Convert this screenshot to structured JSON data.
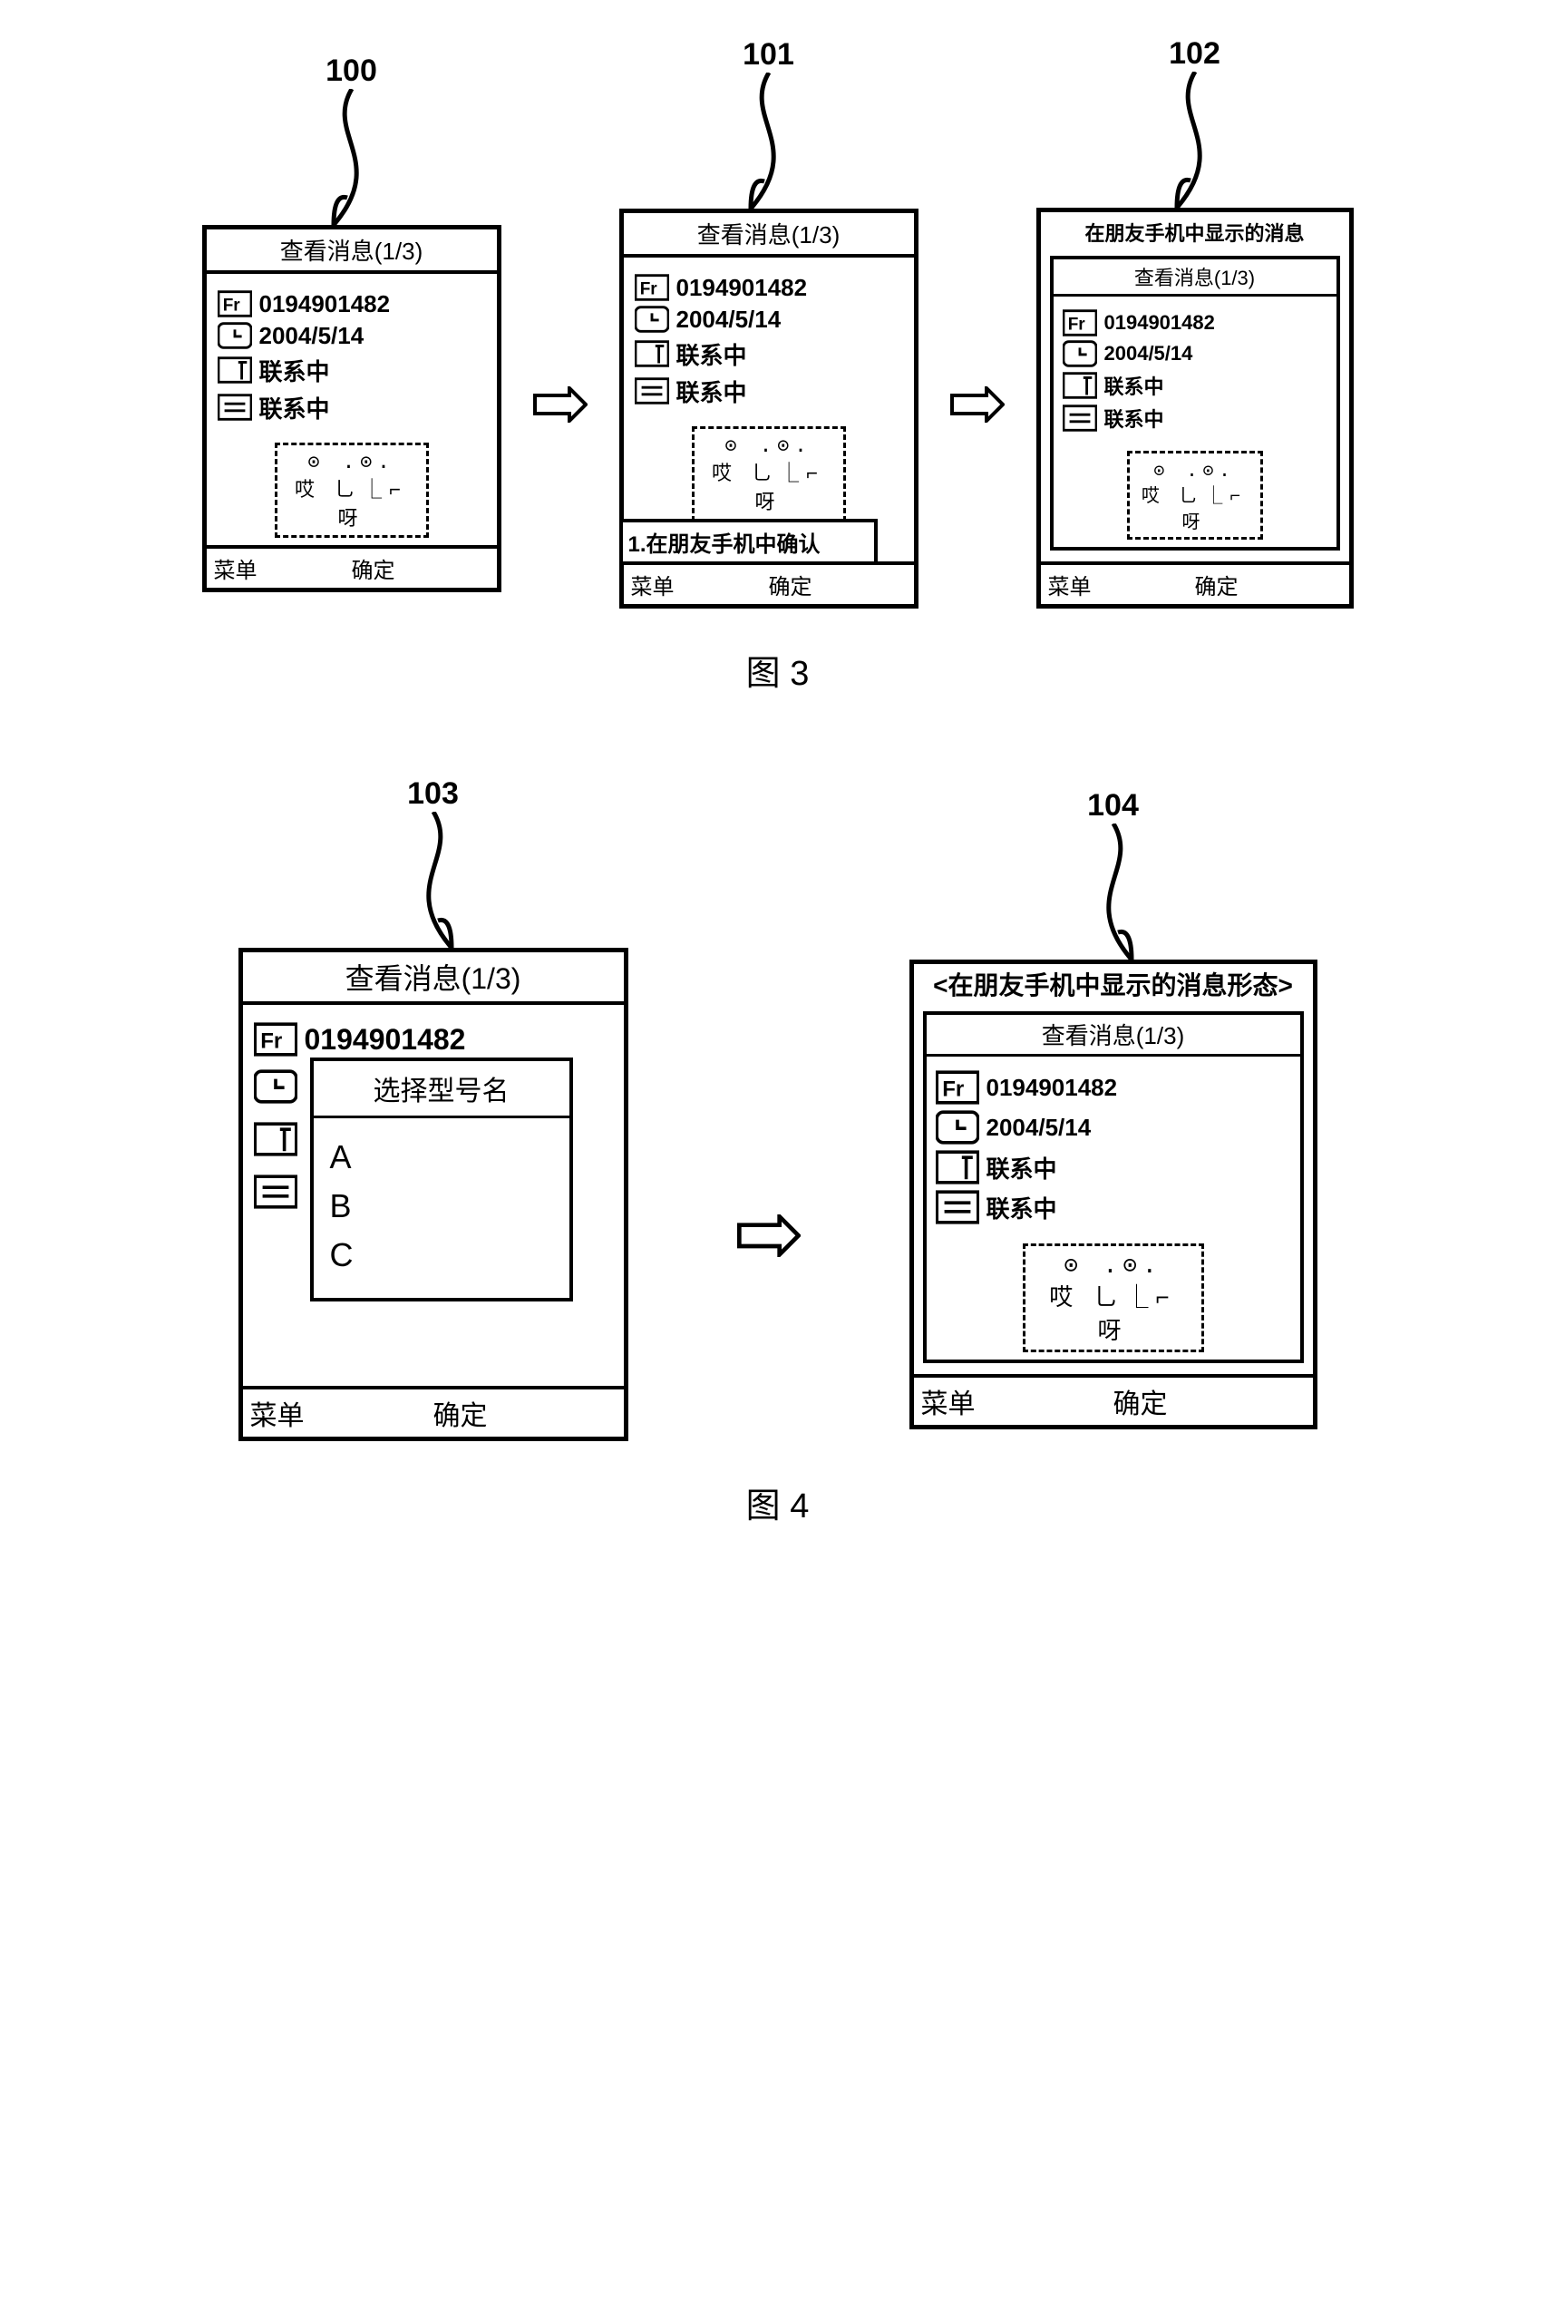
{
  "fig3": {
    "caption": "图 3",
    "screens": [
      {
        "ref": "100",
        "title": "查看消息(1/3)",
        "from": "0194901482",
        "date": "2004/5/14",
        "status1": "联系中",
        "status2": "联系中",
        "face_top": "⊙ .⊙.",
        "face_bottom": "哎  ⺃⎿⌐  呀",
        "footer_left": "菜单",
        "footer_center": "确定"
      },
      {
        "ref": "101",
        "title": "查看消息(1/3)",
        "from": "0194901482",
        "date": "2004/5/14",
        "status1": "联系中",
        "status2": "联系中",
        "face_top": "⊙ .⊙.",
        "face_bottom": "哎  ⺃⎿⌐  呀",
        "popup": "1.在朋友手机中确认",
        "footer_left": "菜单",
        "footer_center": "确定"
      },
      {
        "ref": "102",
        "outer_title": "在朋友手机中显示的消息",
        "inner_title": "查看消息(1/3)",
        "from": "0194901482",
        "date": "2004/5/14",
        "status1": "联系中",
        "status2": "联系中",
        "face_top": "⊙ .⊙.",
        "face_bottom": "哎  ⺃⎿⌐  呀",
        "footer_left": "菜单",
        "footer_center": "确定"
      }
    ]
  },
  "fig4": {
    "caption": "图 4",
    "screens": [
      {
        "ref": "103",
        "title": "查看消息(1/3)",
        "from": "0194901482",
        "select_title": "选择型号名",
        "options": [
          "A",
          "B",
          "C"
        ],
        "footer_left": "菜单",
        "footer_center": "确定"
      },
      {
        "ref": "104",
        "outer_title": "<在朋友手机中显示的消息形态>",
        "inner_title": "查看消息(1/3)",
        "from": "0194901482",
        "date": "2004/5/14",
        "status1": "联系中",
        "status2": "联系中",
        "face_top": "⊙ .⊙.",
        "face_bottom": "哎  ⺃⎿⌐  呀",
        "footer_left": "菜单",
        "footer_center": "确定"
      }
    ]
  },
  "icons": {
    "from": "Fr",
    "clock": "clock-icon",
    "subject": "subject-icon",
    "body": "body-icon"
  }
}
